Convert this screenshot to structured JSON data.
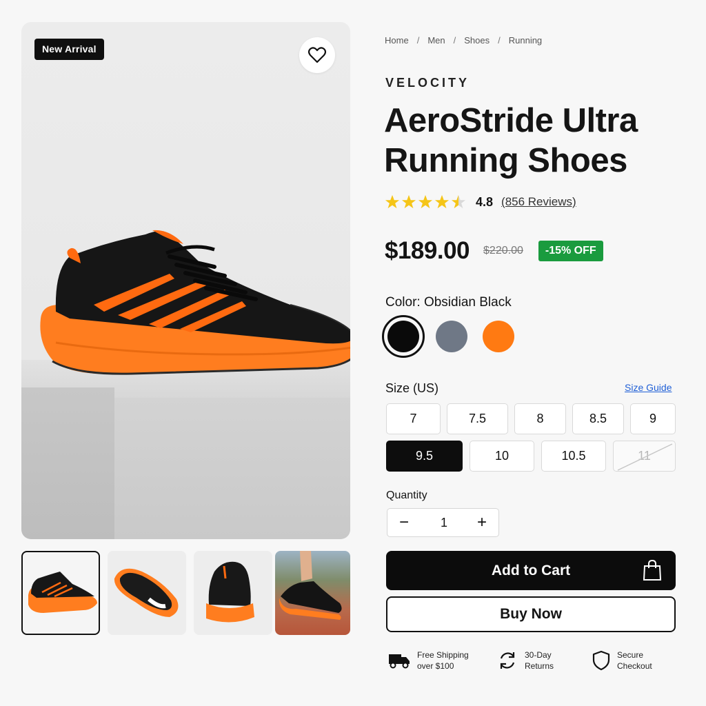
{
  "gallery": {
    "badge": "New Arrival",
    "wishlist_icon": "heart-icon",
    "thumbnails": [
      {
        "name": "side-view",
        "active": true
      },
      {
        "name": "sole-view",
        "active": false
      },
      {
        "name": "rear-view",
        "active": false
      },
      {
        "name": "action-view",
        "active": false
      }
    ]
  },
  "breadcrumb": [
    "Home",
    "Men",
    "Shoes",
    "Running"
  ],
  "breadcrumb_sep": "/",
  "product": {
    "brand": "VELOCITY",
    "title": "AeroStride Ultra Running Shoes",
    "rating": "4.8",
    "rating_stars": 4.5,
    "reviews": "(856 Reviews)",
    "price": "$189.00",
    "old_price": "$220.00",
    "discount": "-15% OFF"
  },
  "color": {
    "label": "Color: Obsidian Black",
    "swatches": [
      {
        "name": "obsidian-black",
        "hex": "#0a0a0a",
        "selected": true
      },
      {
        "name": "slate-gray",
        "hex": "#6f7886",
        "selected": false
      },
      {
        "name": "blaze-orange",
        "hex": "#ff7a12",
        "selected": false
      }
    ]
  },
  "size": {
    "label": "Size (US)",
    "guide": "Size Guide",
    "options": [
      {
        "value": "7",
        "state": "default"
      },
      {
        "value": "7.5",
        "state": "default"
      },
      {
        "value": "8",
        "state": "default"
      },
      {
        "value": "8.5",
        "state": "default"
      },
      {
        "value": "9",
        "state": "default"
      },
      {
        "value": "9.5",
        "state": "selected"
      },
      {
        "value": "10",
        "state": "default"
      },
      {
        "value": "10.5",
        "state": "default"
      },
      {
        "value": "11",
        "state": "disabled"
      }
    ]
  },
  "quantity": {
    "label": "Quantity",
    "minus": "−",
    "value": "1",
    "plus": "+"
  },
  "actions": {
    "add_to_cart": "Add to Cart",
    "buy_now": "Buy Now"
  },
  "perks": [
    {
      "icon": "truck-icon",
      "line1": "Free Shipping",
      "line2": "over $100"
    },
    {
      "icon": "returns-icon",
      "line1": "30-Day",
      "line2": "Returns"
    },
    {
      "icon": "shield-icon",
      "line1": "Secure",
      "line2": "Checkout"
    }
  ],
  "colors": {
    "accent_orange": "#ff7a12",
    "discount_green": "#1a9b3e",
    "star_yellow": "#f5c518",
    "link_blue": "#1f5fd6"
  }
}
